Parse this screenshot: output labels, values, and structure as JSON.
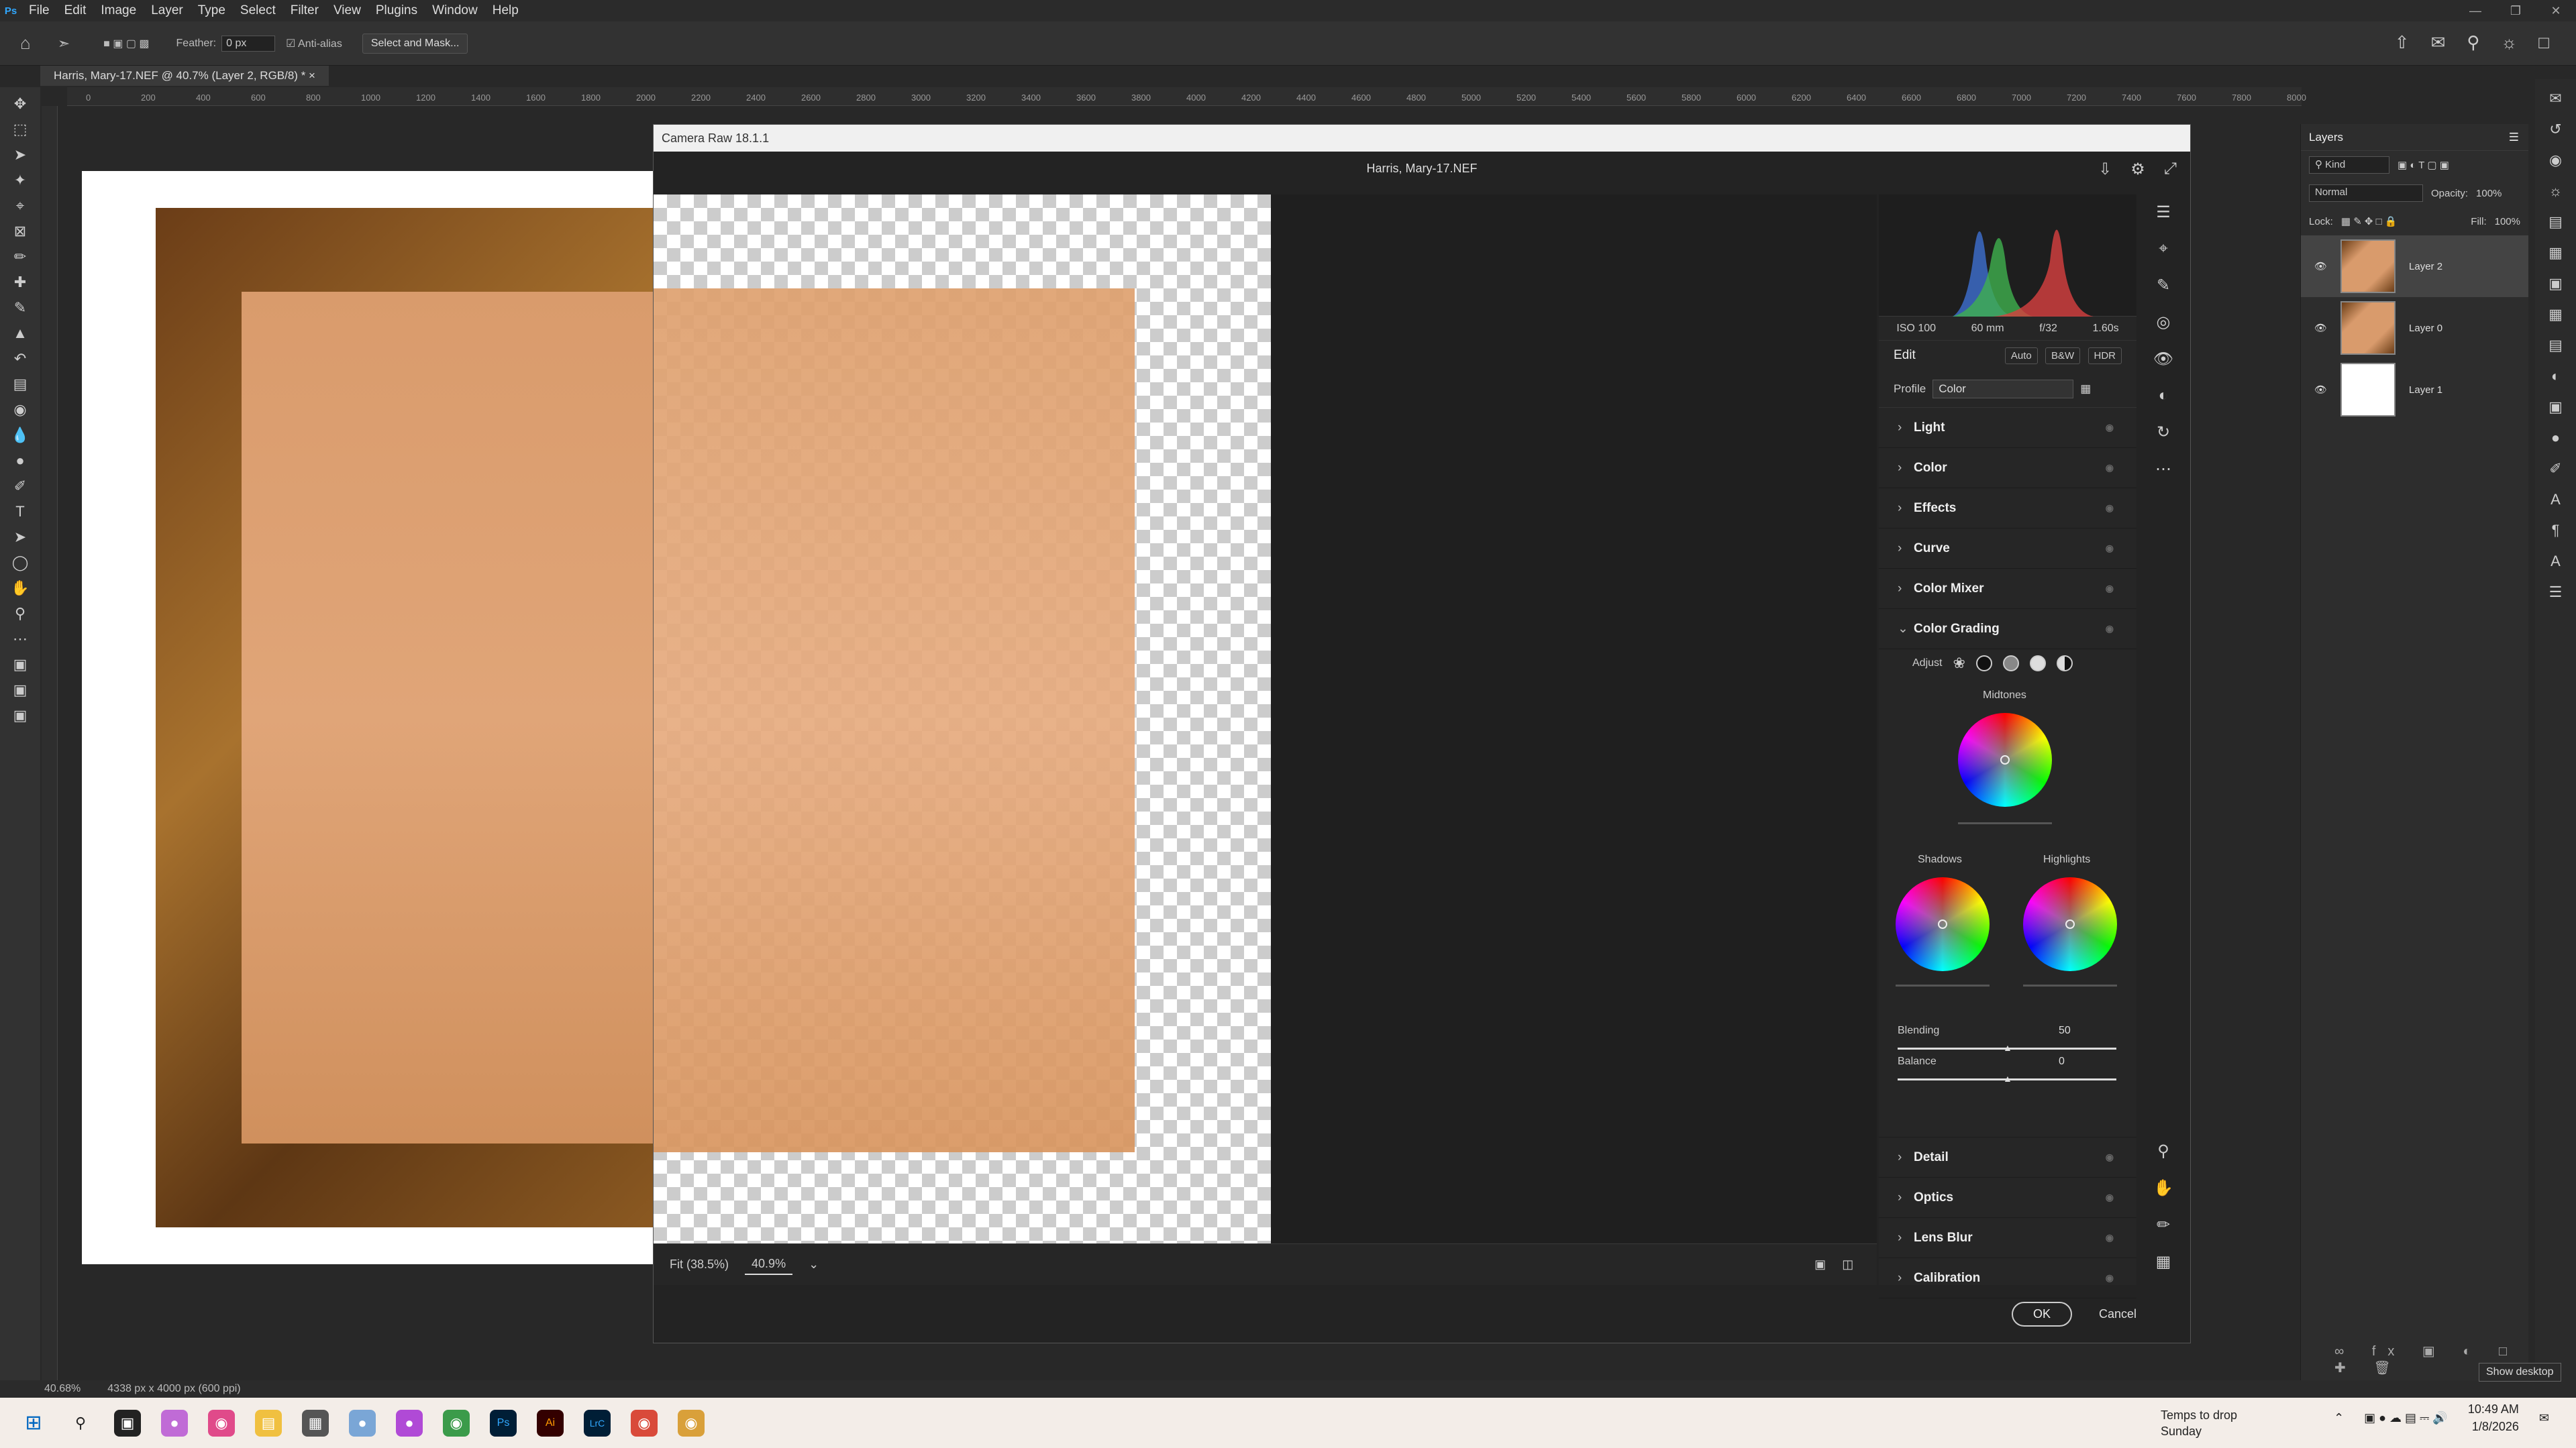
{
  "menubar": {
    "items": [
      "File",
      "Edit",
      "Image",
      "Layer",
      "Type",
      "Select",
      "Filter",
      "View",
      "Plugins",
      "Window",
      "Help"
    ]
  },
  "options": {
    "feather_label": "Feather:",
    "feather_value": "0 px",
    "antialias_label": "Anti-alias",
    "select_mask": "Select and Mask..."
  },
  "doc_tab": {
    "title": "Harris, Mary-17.NEF @ 40.7% (Layer 2, RGB/8) *"
  },
  "ruler": {
    "ticks": [
      "0",
      "200",
      "400",
      "600",
      "800",
      "1000",
      "1200",
      "1400",
      "1600",
      "1800",
      "2000",
      "2200",
      "2400",
      "2600",
      "2800",
      "3000",
      "3200",
      "3400",
      "3600",
      "3800",
      "4000",
      "4200",
      "4400",
      "4600",
      "4800",
      "5000",
      "5200",
      "5400",
      "5600",
      "5800",
      "6000",
      "6200",
      "6400",
      "6600",
      "6800",
      "7000",
      "7200",
      "7400",
      "7600",
      "7800",
      "8000"
    ]
  },
  "statusbar": {
    "zoom": "40.68%",
    "size": "4338 px x 4000 px (600 ppi)"
  },
  "camera_raw": {
    "title": "Camera Raw 18.1.1",
    "filename": "Harris, Mary-17.NEF",
    "exif": {
      "iso": "ISO 100",
      "focal": "60 mm",
      "aperture": "f/32",
      "shutter": "1.60s"
    },
    "edit_label": "Edit",
    "edit_btns": {
      "auto": "Auto",
      "bw": "B&W",
      "hdr": "HDR"
    },
    "profile_label": "Profile",
    "profile_value": "Color",
    "sections_top": [
      "Light",
      "Color",
      "Effects",
      "Curve",
      "Color Mixer"
    ],
    "color_grading": {
      "title": "Color Grading",
      "adjust": "Adjust",
      "midtones": "Midtones",
      "shadows": "Shadows",
      "highlights": "Highlights",
      "blending_label": "Blending",
      "blending_value": "50",
      "balance_label": "Balance",
      "balance_value": "0",
      "blending_frac": 0.5,
      "balance_frac": 0.5
    },
    "sections_bottom": [
      "Detail",
      "Optics",
      "Lens Blur",
      "Calibration"
    ],
    "zoom_fit": "Fit (38.5%)",
    "zoom_value": "40.9%",
    "ok": "OK",
    "cancel": "Cancel"
  },
  "layers": {
    "title": "Layers",
    "kind": "Kind",
    "blend": "Normal",
    "opacity_label": "Opacity:",
    "opacity_value": "100%",
    "lock_label": "Lock:",
    "fill_label": "Fill:",
    "fill_value": "100%",
    "items": [
      {
        "name": "Layer 2"
      },
      {
        "name": "Layer 0"
      },
      {
        "name": "Layer 1"
      }
    ]
  },
  "taskbar": {
    "weather_title": "Temps to drop",
    "weather_sub": "Sunday",
    "time": "10:49 AM",
    "date": "1/8/2026",
    "show_desktop": "Show desktop"
  }
}
